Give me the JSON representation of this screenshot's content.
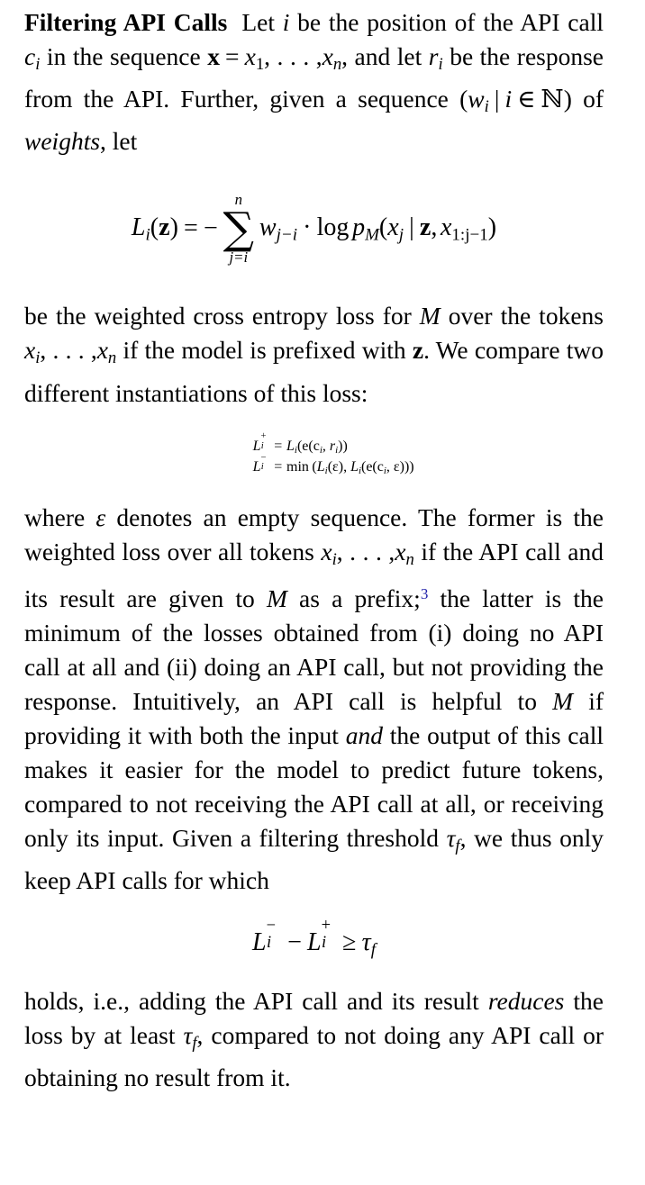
{
  "document": {
    "type": "academic-paper-column",
    "section_runin_heading": "Filtering API Calls",
    "colors": {
      "text": "#000000",
      "footnote_link": "#2222AA",
      "background": "#ffffff"
    }
  },
  "paragraphs": {
    "p1": {
      "heading": "Filtering API Calls",
      "t1": "Let ",
      "m_i": "i",
      "t2": " be the position of the API call ",
      "m_c": "c",
      "m_c_sub": "i",
      "t3": " in the sequence ",
      "m_x_bold": "x",
      "m_eq": "=",
      "m_x1": "x",
      "m_x1_sub": "1",
      "m_comma_dots": ", . . . ,",
      "m_xn": "x",
      "m_xn_sub": "n",
      "t4": ", and let ",
      "m_r": "r",
      "m_r_sub": "i",
      "t5": " be the response from the API. Further, given a sequence ",
      "m_paren_open": "(",
      "m_w": "w",
      "m_w_sub": "i",
      "m_bar": "|",
      "m_i2": "i",
      "m_in": "∈",
      "m_N": "ℕ",
      "m_paren_close": ")",
      "t6": " of ",
      "t6_italic": "weights",
      "t7": ", let"
    },
    "p2": {
      "t1": "be the weighted cross entropy loss for ",
      "m_M": "M",
      "t2": " over the tokens ",
      "m_xi": "x",
      "m_xi_sub": "i",
      "m_dots": ", . . . ,",
      "m_xn": "x",
      "m_xn_sub": "n",
      "t3": " if the model is prefixed with ",
      "m_z_bold": "z",
      "t4": ". We compare two different instantiations of this loss:"
    },
    "p3": {
      "t1": "where ",
      "m_eps": "ε",
      "t2": " denotes an empty sequence. The former is the weighted loss over all tokens ",
      "m_xi": "x",
      "m_xi_sub": "i",
      "m_dots": ", . . . ,",
      "m_xn": "x",
      "m_xn_sub": "n",
      "t3": " if the API call and its result are given to ",
      "m_M": "M",
      "t4": " as a prefix;",
      "footnote_marker": "3",
      "t5": " the latter is the minimum of the losses obtained from (i) doing no API call at all and (ii) doing an API call, but not providing the response. Intuitively, an API call is helpful to ",
      "m_M2": "M",
      "t6": " if providing it with both the input ",
      "t6_italic": "and",
      "t7": " the output of this call makes it easier for the model to predict future tokens, compared to not receiving the API call at all, or receiving only its input. Given a filtering threshold ",
      "m_tau": "τ",
      "m_tau_sub": "f",
      "t8": ", we thus only keep API calls for which"
    },
    "p4": {
      "t1": "holds, i.e., adding the API call and its result ",
      "t1_italic": "reduces",
      "t2": " the loss by at least ",
      "m_tau": "τ",
      "m_tau_sub": "f",
      "t3": ", compared to not doing any API call or obtaining no result from it."
    }
  },
  "equations": {
    "eq1": {
      "latex": "L_i(\\mathbf{z}) = -\\sum_{j=i}^{n} w_{j-i} \\cdot \\log p_M(x_j \\mid \\mathbf{z}, x_{1:j-1})",
      "lhs_L": "L",
      "lhs_sub": "i",
      "lhs_paren_open": "(",
      "lhs_z": "z",
      "lhs_paren_close": ")",
      "rel": "=",
      "minus": "−",
      "sum_top": "n",
      "sum_sym": "∑",
      "sum_bot": "j=i",
      "w": "w",
      "w_sub": "j−i",
      "cdot": "·",
      "log": "log",
      "p": "p",
      "p_sub": "M",
      "paren_open": "(",
      "x": "x",
      "x_sub": "j",
      "mid": "|",
      "z": "z",
      "comma": ",",
      "x2": "x",
      "x2_sub": "1:j−1",
      "paren_close": ")"
    },
    "eq2": {
      "latex": "L_i^{+} = L_i(\\mathrm{e}(c_i, r_i))",
      "lhs_L": "L",
      "lhs_sup": "+",
      "lhs_sub": "i",
      "rel": "=",
      "rhs_L": "L",
      "rhs_L_sub": "i",
      "rhs": "(e(c",
      "rhs_sub1": "i",
      "rhs_mid": ", r",
      "rhs_sub2": "i",
      "rhs_end": "))"
    },
    "eq3": {
      "latex": "L_i^{-} = \\min\\left(L_i(\\varepsilon), L_i(\\mathrm{e}(c_i, \\varepsilon))\\right)",
      "lhs_L": "L",
      "lhs_sup": "−",
      "lhs_sub": "i",
      "rel": "=",
      "min": "min",
      "open": "(",
      "L1": "L",
      "L1_sub": "i",
      "eps1": "(ε), ",
      "L2": "L",
      "L2_sub": "i",
      "mid": "(e(c",
      "c_sub": "i",
      "eps2": ", ε))",
      "close": ")"
    },
    "eq4": {
      "latex": "L_i^{-} - L_i^{+} \\geq \\tau_f",
      "lhs_L": "L",
      "lhs_sup": "−",
      "lhs_sub": "i",
      "minus": "−",
      "rhs_L": "L",
      "rhs_sup": "+",
      "rhs_sub": "i",
      "rel": "≥",
      "tau": "τ",
      "tau_sub": "f"
    }
  }
}
